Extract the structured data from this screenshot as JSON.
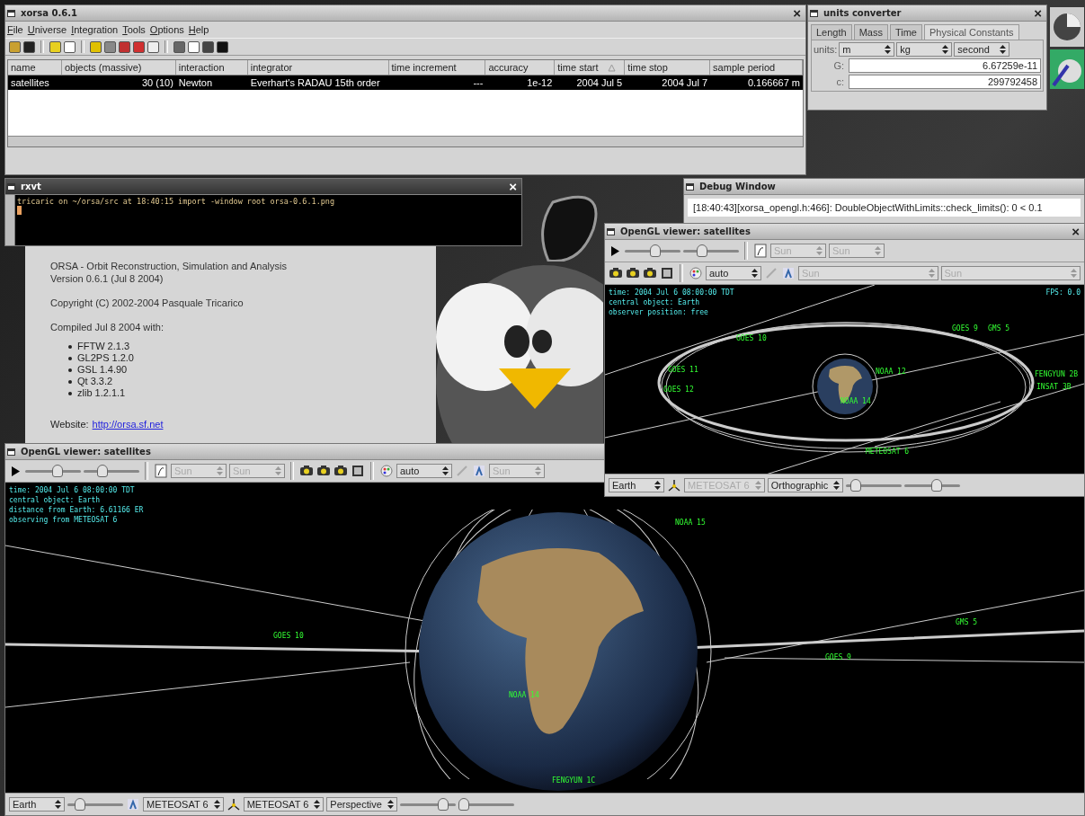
{
  "main_window": {
    "title": "xorsa 0.6.1",
    "close_button": "×",
    "menu": [
      "File",
      "Universe",
      "Integration",
      "Tools",
      "Options",
      "Help"
    ],
    "table": {
      "columns": [
        "name",
        "objects (massive)",
        "interaction",
        "integrator",
        "time increment",
        "accuracy",
        "time start",
        "time stop",
        "sample period"
      ],
      "rows": [
        {
          "cells": [
            "satellites",
            "30 (10)",
            "Newton",
            "Everhart's RADAU 15th order",
            "---",
            "1e-12",
            "2004 Jul 5",
            "2004 Jul 7",
            "0.166667 m"
          ],
          "selected": true
        }
      ]
    }
  },
  "units_converter": {
    "title": "units converter",
    "close_button": "×",
    "tabs": [
      {
        "label": "Length",
        "selected": false
      },
      {
        "label": "Mass",
        "selected": false
      },
      {
        "label": "Time",
        "selected": false
      },
      {
        "label": "Physical Constants",
        "selected": true
      }
    ],
    "units_label": "units:",
    "units": [
      "m",
      "kg",
      "second"
    ],
    "constants": [
      {
        "label": "G:",
        "value": "6.67259e-11"
      },
      {
        "label": "c:",
        "value": "299792458"
      }
    ]
  },
  "debug_window": {
    "title": "Debug Window",
    "message": "[18:40:43][xorsa_opengl.h:466]: DoubleObjectWithLimits::check_limits(): 0 < 0.1"
  },
  "terminal": {
    "title": "rxvt",
    "close_button": "×",
    "line": "tricaric on ~/orsa/src at 18:40:15 import -window root orsa-0.6.1.png"
  },
  "about": {
    "lines": [
      "ORSA - Orbit Reconstruction, Simulation and Analysis",
      "Version 0.6.1 (Jul 8 2004)"
    ],
    "copyright": "Copyright (C) 2002-2004 Pasquale Tricarico",
    "compiled": "Compiled Jul 8 2004 with:",
    "libraries": [
      "FFTW 2.1.3",
      "GL2PS 1.2.0",
      "GSL 1.4.90",
      "Qt 3.3.2",
      "zlib 1.2.1.1"
    ],
    "website_label": "Website:",
    "website_link": "http://orsa.sf.net"
  },
  "viewer_large": {
    "title": "OpenGL viewer: satellites",
    "toolbar": [
      {
        "kind": "play"
      },
      {
        "kind": "slider",
        "level": 0.6
      },
      {
        "kind": "slider",
        "level": 0.3
      },
      {
        "kind": "separator"
      },
      {
        "kind": "page"
      },
      {
        "kind": "select",
        "value": "Sun",
        "disabled": true
      },
      {
        "kind": "select",
        "value": "Sun",
        "disabled": true
      },
      {
        "kind": "separator"
      },
      {
        "kind": "camera"
      },
      {
        "kind": "camera"
      },
      {
        "kind": "camera"
      },
      {
        "kind": "film"
      },
      {
        "kind": "separator"
      },
      {
        "kind": "palette"
      },
      {
        "kind": "select",
        "value": "auto",
        "disabled": false
      },
      {
        "kind": "pen"
      },
      {
        "kind": "figure"
      },
      {
        "kind": "select",
        "value": "Sun",
        "disabled": true
      }
    ],
    "info": [
      "time: 2004 Jul 6 08:00:00 TDT",
      "central object: Earth",
      "distance from Earth: 6.61166 ER",
      "observing from METEOSAT 6"
    ],
    "labels": [
      "NOAA 15",
      "GOES 10",
      "NOAA 14",
      "GOES 9",
      "GMS 5",
      "FENGYUN 1C"
    ],
    "bottom_bar": [
      {
        "kind": "select",
        "value": "Earth",
        "disabled": false
      },
      {
        "kind": "slider",
        "level": 0.15
      },
      {
        "kind": "figure"
      },
      {
        "kind": "select",
        "value": "METEOSAT 6",
        "disabled": false
      },
      {
        "kind": "axes"
      },
      {
        "kind": "select",
        "value": "METEOSAT 6",
        "disabled": false
      },
      {
        "kind": "select",
        "value": "Perspective",
        "disabled": false
      },
      {
        "kind": "slider",
        "level": 0.85
      },
      {
        "kind": "slider",
        "level": 0.0
      }
    ]
  },
  "viewer_small": {
    "title": "OpenGL viewer: satellites",
    "close_button": "×",
    "toolbar_top": [
      {
        "kind": "play"
      },
      {
        "kind": "slider",
        "level": 0.55
      },
      {
        "kind": "slider",
        "level": 0.3
      },
      {
        "kind": "separator"
      },
      {
        "kind": "page"
      },
      {
        "kind": "select",
        "value": "Sun",
        "disabled": true
      },
      {
        "kind": "select",
        "value": "Sun",
        "disabled": true
      }
    ],
    "toolbar_bottom": [
      {
        "kind": "camera"
      },
      {
        "kind": "camera"
      },
      {
        "kind": "camera"
      },
      {
        "kind": "film"
      },
      {
        "kind": "separator"
      },
      {
        "kind": "palette"
      },
      {
        "kind": "select",
        "value": "auto",
        "disabled": false
      },
      {
        "kind": "pen"
      },
      {
        "kind": "figure"
      },
      {
        "kind": "select",
        "value": "Sun",
        "disabled": true
      },
      {
        "kind": "select",
        "value": "Sun",
        "disabled": true
      }
    ],
    "info": [
      "time: 2004 Jul 6 08:00:00 TDT",
      "central object: Earth",
      "observer position: free"
    ],
    "fps": "FPS: 0.0",
    "labels": [
      "GOES 10",
      "GOES 9",
      "GMS 5",
      "GOES 11",
      "GOES 12",
      "NOAA 12",
      "FENGYUN 2B",
      "INSAT 3B",
      "NOAA 14",
      "METEOSAT 6"
    ],
    "bottom_bar": [
      {
        "kind": "select",
        "value": "Earth",
        "disabled": false
      },
      {
        "kind": "axes"
      },
      {
        "kind": "select",
        "value": "METEOSAT 6",
        "disabled": true
      },
      {
        "kind": "select",
        "value": "Orthographic",
        "disabled": false
      },
      {
        "kind": "slider",
        "level": 0.1
      },
      {
        "kind": "slider",
        "level": 0.6
      }
    ]
  }
}
